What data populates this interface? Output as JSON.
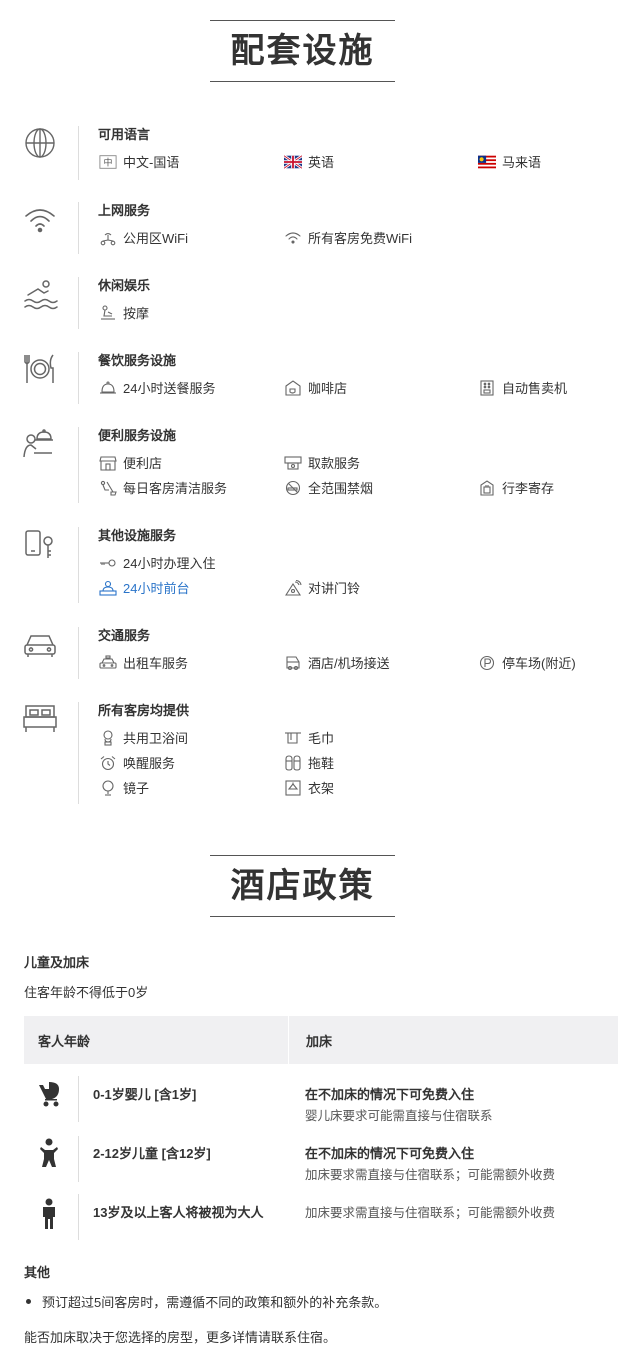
{
  "facilities_title": "配套设施",
  "policy_title": "酒店政策",
  "categories": [
    {
      "title": "可用语言",
      "icon": "globe-icon",
      "items": [
        {
          "label": "中文-国语",
          "icon": "zh-flag-icon"
        },
        {
          "label": "英语",
          "icon": "uk-flag-icon"
        },
        {
          "label": "马来语",
          "icon": "my-flag-icon"
        }
      ]
    },
    {
      "title": "上网服务",
      "icon": "wifi-icon",
      "items": [
        {
          "label": "公用区WiFi",
          "icon": "network-icon"
        },
        {
          "label": "所有客房免费WiFi",
          "icon": "wifi-icon"
        }
      ]
    },
    {
      "title": "休闲娱乐",
      "icon": "swimmer-icon",
      "items": [
        {
          "label": "按摩",
          "icon": "massage-icon"
        }
      ]
    },
    {
      "title": "餐饮服务设施",
      "icon": "dining-icon",
      "items": [
        {
          "label": "24小时送餐服务",
          "icon": "cloche-icon"
        },
        {
          "label": "咖啡店",
          "icon": "cafe-icon"
        },
        {
          "label": "自动售卖机",
          "icon": "vending-icon"
        }
      ]
    },
    {
      "title": "便利服务设施",
      "icon": "service-tray-icon",
      "items": [
        {
          "label": "便利店",
          "icon": "store-icon"
        },
        {
          "label": "取款服务",
          "icon": "atm-icon"
        },
        {
          "label": "每日客房清洁服务",
          "icon": "cleaning-icon"
        },
        {
          "label": "全范围禁烟",
          "icon": "no-smoking-icon"
        },
        {
          "label": "行李寄存",
          "icon": "luggage-icon"
        }
      ]
    },
    {
      "title": "其他设施服务",
      "icon": "phone-key-icon",
      "items": [
        {
          "label": "24小时办理入住",
          "icon": "key-icon"
        },
        {
          "label": "24小时前台",
          "icon": "reception-icon"
        },
        {
          "label": "对讲门铃",
          "icon": "intercom-icon"
        }
      ]
    },
    {
      "title": "交通服务",
      "icon": "car-icon",
      "items": [
        {
          "label": "出租车服务",
          "icon": "taxi-icon"
        },
        {
          "label": "酒店/机场接送",
          "icon": "shuttle-icon"
        },
        {
          "label": "停车场(附近)",
          "icon": "parking-icon"
        }
      ]
    },
    {
      "title": "所有客房均提供",
      "icon": "bed-icon",
      "items": [
        {
          "label": "共用卫浴间",
          "icon": "toilet-icon"
        },
        {
          "label": "毛巾",
          "icon": "towel-icon"
        },
        {
          "label": "唤醒服务",
          "icon": "alarm-icon"
        },
        {
          "label": "拖鞋",
          "icon": "slippers-icon"
        },
        {
          "label": "镜子",
          "icon": "mirror-icon"
        },
        {
          "label": "衣架",
          "icon": "wardrobe-icon"
        }
      ]
    }
  ],
  "policy": {
    "children_heading": "儿童及加床",
    "min_age": "住客年龄不得低于0岁",
    "table_headers": [
      "客人年龄",
      "加床"
    ],
    "rows": [
      {
        "age": "0-1岁婴儿 [含1岁]",
        "main": "在不加床的情况下可免费入住",
        "sub": "婴儿床要求可能需直接与住宿联系",
        "icon": "stroller-icon"
      },
      {
        "age": "2-12岁儿童 [含12岁]",
        "main": "在不加床的情况下可免费入住",
        "sub": "加床要求需直接与住宿联系；可能需额外收费",
        "icon": "child-icon"
      },
      {
        "age": "13岁及以上客人将被视为大人",
        "main": "",
        "sub": "加床要求需直接与住宿联系；可能需额外收费",
        "icon": "adult-icon"
      }
    ],
    "other_heading": "其他",
    "other_bullet": "预订超过5间客房时，需遵循不同的政策和额外的补充条款。",
    "footer": "能否加床取决于您选择的房型，更多详情请联系住宿。"
  }
}
